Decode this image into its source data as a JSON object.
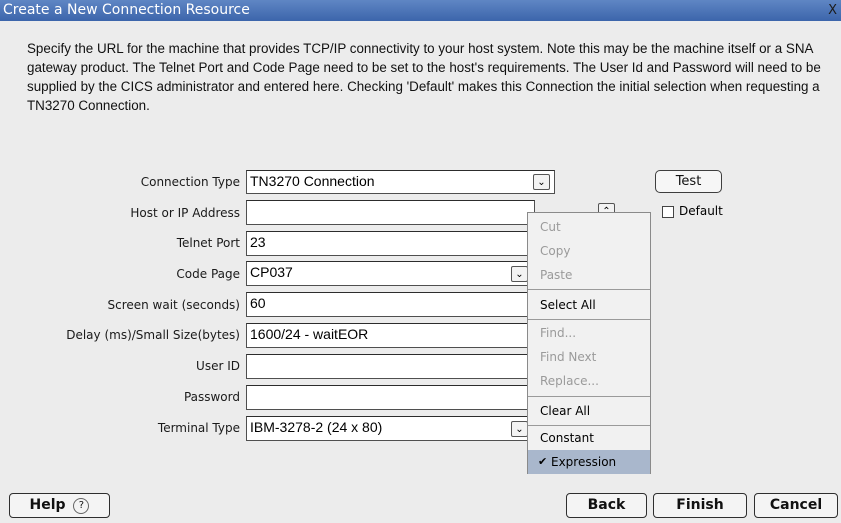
{
  "window": {
    "title": "Create a New Connection Resource",
    "close_glyph": "X"
  },
  "description": "Specify the URL for the machine that provides TCP/IP connectivity to your host system.  Note this may be the machine itself or a SNA gateway product. The Telnet Port and Code Page need to be set to the host's requirements. The User Id and Password will need to be supplied by the CICS administrator and entered here. Checking 'Default' makes this Connection the initial selection when requesting a TN3270 Connection.",
  "form": {
    "connection_type": {
      "label": "Connection Type",
      "value": "TN3270 Connection"
    },
    "host": {
      "label": "Host or IP Address",
      "value": ""
    },
    "telnet_port": {
      "label": "Telnet Port",
      "value": "23"
    },
    "code_page": {
      "label": "Code Page",
      "value": "CP037"
    },
    "screen_wait": {
      "label": "Screen wait (seconds)",
      "value": "60"
    },
    "delay": {
      "label": "Delay (ms)/Small Size(bytes)",
      "value": "1600/24 - waitEOR"
    },
    "user_id": {
      "label": "User ID",
      "value": ""
    },
    "password": {
      "label": "Password",
      "value": ""
    },
    "terminal_type": {
      "label": "Terminal Type",
      "value": "IBM-3278-2 (24 x 80)"
    }
  },
  "test_button": "Test",
  "default_checkbox": {
    "label": "Default",
    "checked": false
  },
  "context_menu": {
    "items": [
      {
        "label": "Cut",
        "enabled": false
      },
      {
        "label": "Copy",
        "enabled": false
      },
      {
        "label": "Paste",
        "enabled": false
      },
      {
        "label": "Select All",
        "enabled": true
      },
      {
        "label": "Find...",
        "enabled": false
      },
      {
        "label": "Find Next",
        "enabled": false
      },
      {
        "label": "Replace...",
        "enabled": false
      },
      {
        "label": "Clear All",
        "enabled": true
      },
      {
        "label": "Constant",
        "enabled": true
      },
      {
        "label": "Expression",
        "enabled": true,
        "checked": true,
        "highlighted": true
      }
    ],
    "check_glyph": "✔"
  },
  "footer": {
    "help": "Help",
    "help_glyph": "?",
    "back": "Back",
    "finish": "Finish",
    "cancel": "Cancel"
  },
  "colors": {
    "title_bar": "#3c65ab",
    "menu_highlight": "#a9b7cc"
  }
}
